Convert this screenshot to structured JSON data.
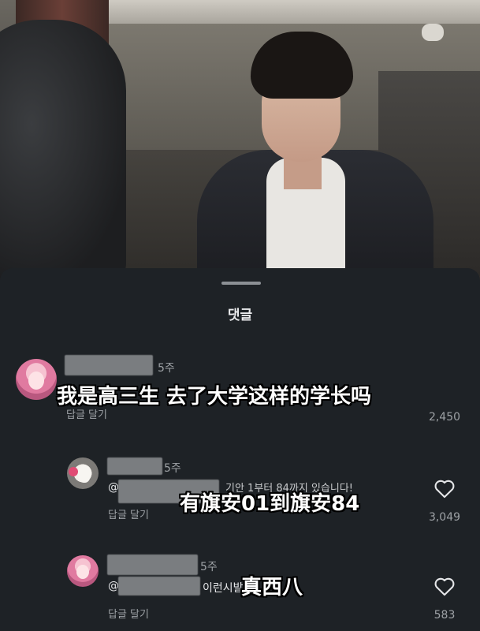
{
  "sheet": {
    "title": "댓글"
  },
  "comments": [
    {
      "time": "5주",
      "reply_label": "답글 달기",
      "like_count": "2,450",
      "overlay": "我是高三生 去了大学这样的学长吗"
    },
    {
      "time": "5주",
      "mention": "@",
      "text_fragment": "기안 1부터 84까지 있습니다!",
      "reply_label": "답글 달기",
      "like_count": "3,049",
      "overlay": "有旗安01到旗安84"
    },
    {
      "time": "5주",
      "mention": "@",
      "text_fragment": "이런시발",
      "reply_label": "답글 달기",
      "like_count": "583",
      "overlay": "真西八"
    }
  ],
  "icons": {
    "like": "heart-icon"
  },
  "colors": {
    "sheet_bg": "#1e2226",
    "text_primary": "#e6e7e9",
    "text_secondary": "#9ea2a6"
  }
}
